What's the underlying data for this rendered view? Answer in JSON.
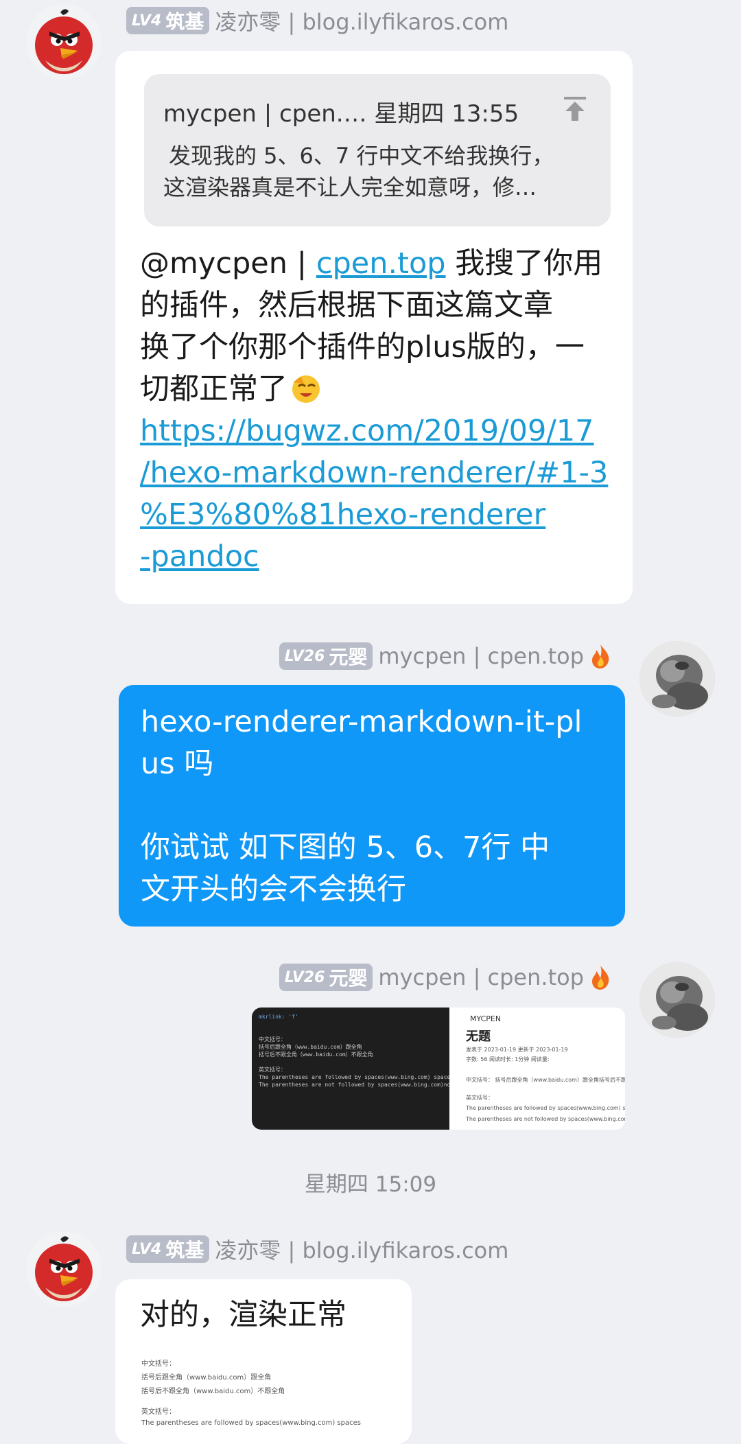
{
  "messages": [
    {
      "sender": {
        "level": "LV4",
        "title": "筑基",
        "name": "凌亦零 | blog.ilyfikaros.com"
      },
      "quote": {
        "header": "mycpen | cpen.…  星期四 13:55",
        "body_line1": "发现我的 5、6、7 行中文不给我换行，",
        "body_line2": "这渲染器真是不让人完全如意呀，修…"
      },
      "text_mention": "@mycpen | ",
      "text_mention_link": "cpen.top",
      "text_line1_rest": " 我搜了你用",
      "text_line2": "的插件，然后根据下面这篇文章",
      "text_line3": "换了个你那个插件的plus版的，一",
      "text_line4": "切都正常了",
      "link_line1": "https://bugwz.com/2019/09/17",
      "link_line2": "/hexo-markdown-renderer/#1-3",
      "link_line3": "%E3%80%81hexo-renderer",
      "link_line4": "-pandoc"
    },
    {
      "sender": {
        "level": "LV26",
        "title": "元婴",
        "name": "mycpen | cpen.top"
      },
      "text_line1": "hexo-renderer-markdown-it-pl",
      "text_line2": "us 吗",
      "text_line3": "你试试 如下图的 5、6、7行 中",
      "text_line4": "文开头的会不会换行"
    },
    {
      "sender": {
        "level": "LV26",
        "title": "元婴",
        "name": "mycpen | cpen.top"
      },
      "image": {
        "code": [
          "mkrlink: 'f'",
          "",
          "",
          "中文括号：",
          "括号后跟全角（www.baidu.com）跟全角",
          "括号后不跟全角（www.baidu.com）不跟全角",
          "",
          "英文括号：",
          "The parentheses are followed by spaces(www.bing.com) spaces",
          "The parentheses are not followed by spaces(www.bing.com)no spaces"
        ],
        "preview_brand": "MYCPEN",
        "preview_title": "无题",
        "preview_meta1": "发表于 2023-01-19   更新于 2023-01-19",
        "preview_meta2": "字数: 56   阅读时长: 1分钟   阅读量:",
        "preview_l1": "中文括号： 括号后跟全角（www.baidu.com）跟全角括号后不跟",
        "preview_l2": "英文括号：",
        "preview_l3": "The parentheses are followed by spaces(www.bing.com) spaces",
        "preview_l4": "The parentheses are not followed by spaces(www.bing.com)no"
      }
    },
    {
      "timestamp": "星期四 15:09"
    },
    {
      "sender": {
        "level": "LV4",
        "title": "筑基",
        "name": "凌亦零 | blog.ilyfikaros.com"
      },
      "text_line1": "对的，渲染正常",
      "image": {
        "l1": "中文括号：",
        "l2": "括号后跟全角（www.baidu.com）跟全角",
        "l3": "括号后不跟全角（www.baidu.com）不跟全角",
        "l4": "英文括号：",
        "l5": "The parentheses are followed by spaces(www.bing.com) spaces"
      }
    }
  ]
}
